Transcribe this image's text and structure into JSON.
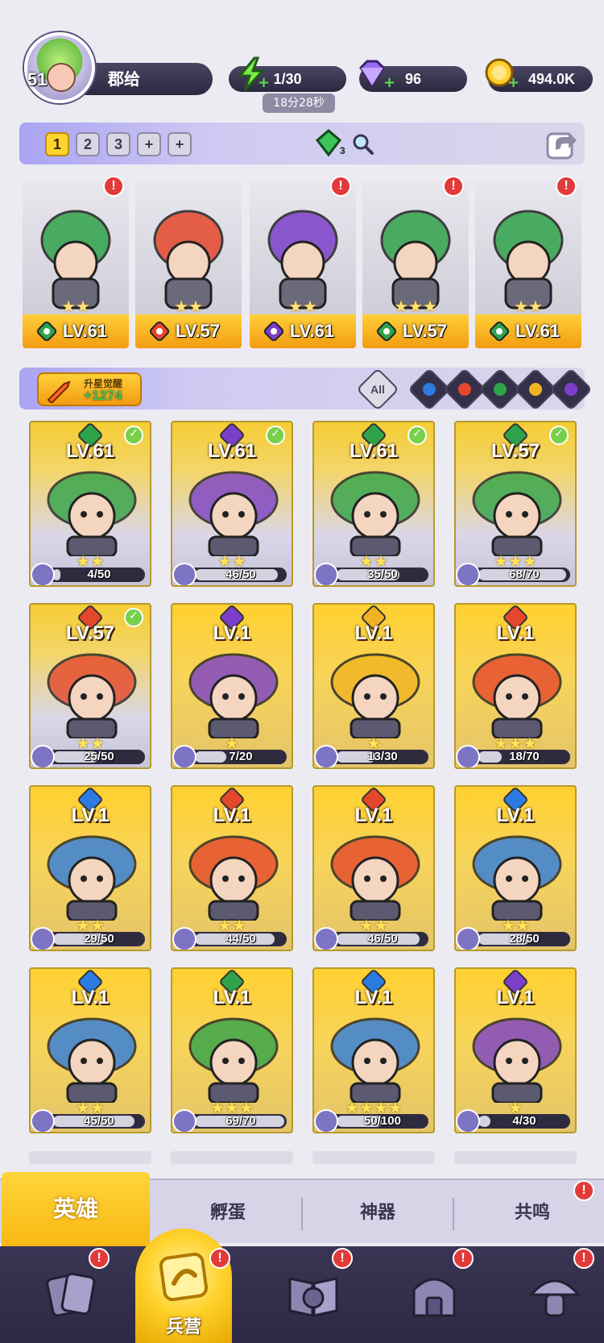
{
  "player": {
    "level": "51",
    "name": "郡给"
  },
  "resources": {
    "energy": "1/30",
    "energy_timer": "18分28秒",
    "gems": "96",
    "gold": "494.0K"
  },
  "teams": {
    "slots": [
      "1",
      "2",
      "3",
      "+",
      "+"
    ],
    "active": "1",
    "gem_badge": "3"
  },
  "lineup": [
    {
      "level": "LV.61",
      "element": "wind",
      "stars": "★★",
      "alert": "!"
    },
    {
      "level": "LV.57",
      "element": "fire",
      "stars": "★★",
      "alert": ""
    },
    {
      "level": "LV.61",
      "element": "dark",
      "stars": "★★",
      "alert": "!"
    },
    {
      "level": "LV.57",
      "element": "wind",
      "stars": "★★★",
      "alert": "!"
    },
    {
      "level": "LV.61",
      "element": "wind",
      "stars": "★★",
      "alert": "!"
    }
  ],
  "filter": {
    "awaken_title": "升星觉醒",
    "awaken_value": "+1274",
    "all_label": "All",
    "elements": [
      "water",
      "fire",
      "wind",
      "light",
      "dark"
    ]
  },
  "heroes": [
    {
      "level": "LV.61",
      "element": "wind",
      "stars": "★★",
      "fragments": "4/50",
      "progress": 0.08,
      "check": true
    },
    {
      "level": "LV.61",
      "element": "dark",
      "stars": "★★",
      "fragments": "46/50",
      "progress": 0.92,
      "check": true
    },
    {
      "level": "LV.61",
      "element": "wind",
      "stars": "★★",
      "fragments": "35/50",
      "progress": 0.7,
      "check": true
    },
    {
      "level": "LV.57",
      "element": "wind",
      "stars": "★★★",
      "fragments": "68/70",
      "progress": 0.97,
      "check": true
    },
    {
      "level": "LV.57",
      "element": "fire",
      "stars": "★★",
      "fragments": "25/50",
      "progress": 0.5,
      "check": true
    },
    {
      "level": "LV.1",
      "element": "dark",
      "stars": "★",
      "fragments": "7/20",
      "progress": 0.35,
      "check": false
    },
    {
      "level": "LV.1",
      "element": "light",
      "stars": "★",
      "fragments": "13/30",
      "progress": 0.43,
      "check": false
    },
    {
      "level": "LV.1",
      "element": "fire",
      "stars": "★★★",
      "fragments": "18/70",
      "progress": 0.26,
      "check": false
    },
    {
      "level": "LV.1",
      "element": "water",
      "stars": "★★",
      "fragments": "29/50",
      "progress": 0.58,
      "check": false
    },
    {
      "level": "LV.1",
      "element": "fire",
      "stars": "★★",
      "fragments": "44/50",
      "progress": 0.88,
      "check": false
    },
    {
      "level": "LV.1",
      "element": "fire",
      "stars": "★★",
      "fragments": "46/50",
      "progress": 0.92,
      "check": false
    },
    {
      "level": "LV.1",
      "element": "water",
      "stars": "★★",
      "fragments": "28/50",
      "progress": 0.56,
      "check": false
    },
    {
      "level": "LV.1",
      "element": "water",
      "stars": "★★",
      "fragments": "45/50",
      "progress": 0.9,
      "check": false
    },
    {
      "level": "LV.1",
      "element": "wind",
      "stars": "★★★",
      "fragments": "69/70",
      "progress": 0.99,
      "check": false
    },
    {
      "level": "LV.1",
      "element": "water",
      "stars": "★★★★",
      "fragments": "50/100",
      "progress": 0.5,
      "check": false
    },
    {
      "level": "LV.1",
      "element": "dark",
      "stars": "★",
      "fragments": "4/30",
      "progress": 0.13,
      "check": false
    }
  ],
  "subtabs": {
    "hero": "英雄",
    "hatch": "孵蛋",
    "artifact": "神器",
    "resonance": "共鸣"
  },
  "bottomnav": {
    "camp_label": "兵营",
    "alerts": [
      "!",
      "!",
      "!",
      "!",
      "!"
    ]
  },
  "colors": {
    "wind": "#2fa34a",
    "fire": "#e5472c",
    "dark": "#7b3fc9",
    "water": "#2c7be0",
    "light": "#f0b422",
    "accent_gold": "#ffd02f",
    "alert_red": "#e23a3a"
  }
}
